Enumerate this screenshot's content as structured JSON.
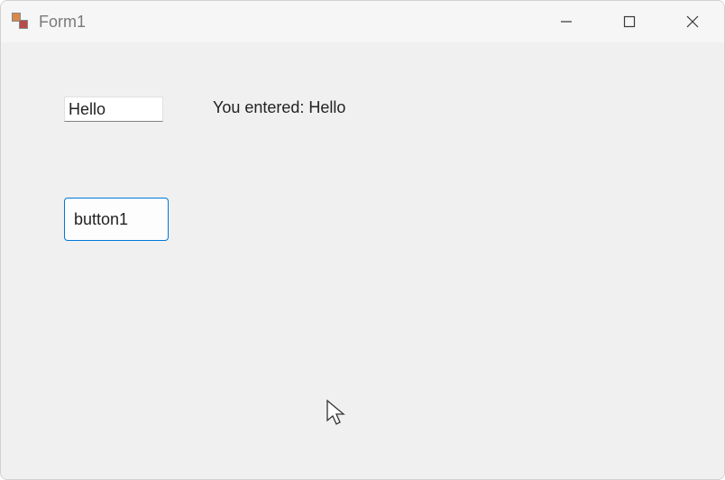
{
  "window": {
    "title": "Form1"
  },
  "form": {
    "textbox_value": "Hello",
    "output_label": "You entered: Hello",
    "button1_label": "button1"
  }
}
